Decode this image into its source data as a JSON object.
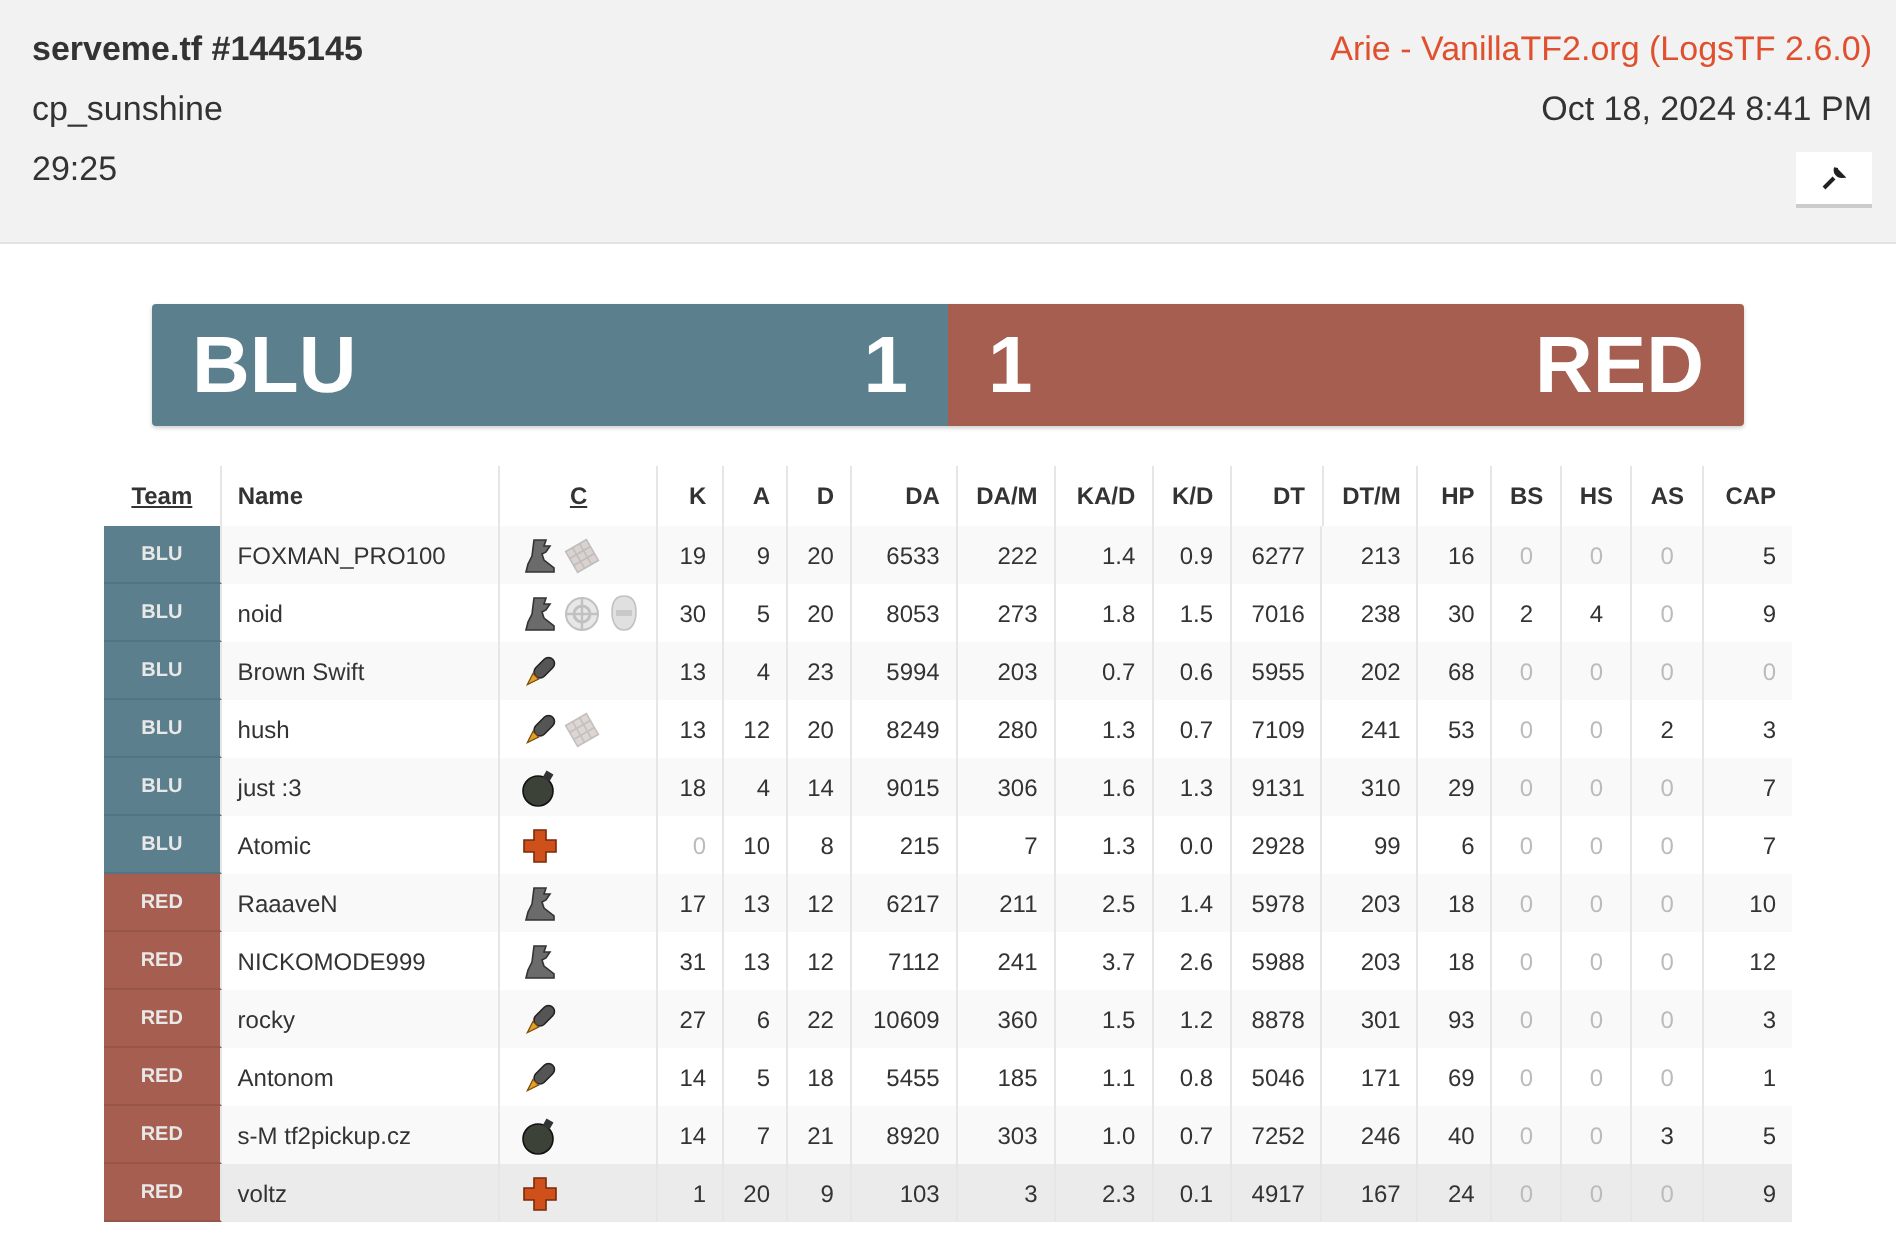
{
  "header": {
    "title": "serveme.tf #1445145",
    "map": "cp_sunshine",
    "duration": "29:25",
    "uploader": "Arie - VanillaTF2.org (LogsTF 2.6.0)",
    "date": "Oct 18, 2024 8:41 PM"
  },
  "score": {
    "blu_name": "BLU",
    "blu_score": "1",
    "red_score": "1",
    "red_name": "RED"
  },
  "table": {
    "columns": [
      {
        "label": "Team",
        "link": true
      },
      {
        "label": "Name",
        "link": false
      },
      {
        "label": "C",
        "link": true
      },
      {
        "label": "K",
        "link": false
      },
      {
        "label": "A",
        "link": false
      },
      {
        "label": "D",
        "link": false
      },
      {
        "label": "DA",
        "link": false
      },
      {
        "label": "DA/M",
        "link": false
      },
      {
        "label": "KA/D",
        "link": false
      },
      {
        "label": "K/D",
        "link": false
      },
      {
        "label": "DT",
        "link": false
      },
      {
        "label": "DT/M",
        "link": false
      },
      {
        "label": "HP",
        "link": false
      },
      {
        "label": "BS",
        "link": false
      },
      {
        "label": "HS",
        "link": false
      },
      {
        "label": "AS",
        "link": false
      },
      {
        "label": "CAP",
        "link": false
      }
    ],
    "rows": [
      {
        "team": "BLU",
        "kind": "blu",
        "name": "FOXMAN_PRO100",
        "highlighted": false,
        "classes": [
          {
            "kind": "boot",
            "faded": false
          },
          {
            "kind": "grid",
            "faded": true
          }
        ],
        "stats": [
          {
            "value": "19",
            "dimmed": false
          },
          {
            "value": "9",
            "dimmed": false
          },
          {
            "value": "20",
            "dimmed": false
          },
          {
            "value": "6533",
            "dimmed": false
          },
          {
            "value": "222",
            "dimmed": false
          },
          {
            "value": "1.4",
            "dimmed": false
          },
          {
            "value": "0.9",
            "dimmed": false
          },
          {
            "value": "6277",
            "dimmed": false
          },
          {
            "value": "213",
            "dimmed": false
          },
          {
            "value": "16",
            "dimmed": false
          },
          {
            "value": "0",
            "dimmed": true
          },
          {
            "value": "0",
            "dimmed": true
          },
          {
            "value": "0",
            "dimmed": true
          },
          {
            "value": "5",
            "dimmed": false
          }
        ]
      },
      {
        "team": "BLU",
        "kind": "blu",
        "name": "noid",
        "highlighted": false,
        "classes": [
          {
            "kind": "boot",
            "faded": false
          },
          {
            "kind": "crosshair",
            "faded": true
          },
          {
            "kind": "mask",
            "faded": true
          }
        ],
        "stats": [
          {
            "value": "30",
            "dimmed": false
          },
          {
            "value": "5",
            "dimmed": false
          },
          {
            "value": "20",
            "dimmed": false
          },
          {
            "value": "8053",
            "dimmed": false
          },
          {
            "value": "273",
            "dimmed": false
          },
          {
            "value": "1.8",
            "dimmed": false
          },
          {
            "value": "1.5",
            "dimmed": false
          },
          {
            "value": "7016",
            "dimmed": false
          },
          {
            "value": "238",
            "dimmed": false
          },
          {
            "value": "30",
            "dimmed": false
          },
          {
            "value": "2",
            "dimmed": false
          },
          {
            "value": "4",
            "dimmed": false
          },
          {
            "value": "0",
            "dimmed": true
          },
          {
            "value": "9",
            "dimmed": false
          }
        ]
      },
      {
        "team": "BLU",
        "kind": "blu",
        "name": "Brown Swift",
        "highlighted": false,
        "classes": [
          {
            "kind": "rocket",
            "faded": false
          }
        ],
        "stats": [
          {
            "value": "13",
            "dimmed": false
          },
          {
            "value": "4",
            "dimmed": false
          },
          {
            "value": "23",
            "dimmed": false
          },
          {
            "value": "5994",
            "dimmed": false
          },
          {
            "value": "203",
            "dimmed": false
          },
          {
            "value": "0.7",
            "dimmed": false
          },
          {
            "value": "0.6",
            "dimmed": false
          },
          {
            "value": "5955",
            "dimmed": false
          },
          {
            "value": "202",
            "dimmed": false
          },
          {
            "value": "68",
            "dimmed": false
          },
          {
            "value": "0",
            "dimmed": true
          },
          {
            "value": "0",
            "dimmed": true
          },
          {
            "value": "0",
            "dimmed": true
          },
          {
            "value": "0",
            "dimmed": true
          }
        ]
      },
      {
        "team": "BLU",
        "kind": "blu",
        "name": "hush",
        "highlighted": false,
        "classes": [
          {
            "kind": "rocket",
            "faded": false
          },
          {
            "kind": "grid",
            "faded": true
          }
        ],
        "stats": [
          {
            "value": "13",
            "dimmed": false
          },
          {
            "value": "12",
            "dimmed": false
          },
          {
            "value": "20",
            "dimmed": false
          },
          {
            "value": "8249",
            "dimmed": false
          },
          {
            "value": "280",
            "dimmed": false
          },
          {
            "value": "1.3",
            "dimmed": false
          },
          {
            "value": "0.7",
            "dimmed": false
          },
          {
            "value": "7109",
            "dimmed": false
          },
          {
            "value": "241",
            "dimmed": false
          },
          {
            "value": "53",
            "dimmed": false
          },
          {
            "value": "0",
            "dimmed": true
          },
          {
            "value": "0",
            "dimmed": true
          },
          {
            "value": "2",
            "dimmed": false
          },
          {
            "value": "3",
            "dimmed": false
          }
        ]
      },
      {
        "team": "BLU",
        "kind": "blu",
        "name": "just :3",
        "highlighted": false,
        "classes": [
          {
            "kind": "bomb",
            "faded": false
          }
        ],
        "stats": [
          {
            "value": "18",
            "dimmed": false
          },
          {
            "value": "4",
            "dimmed": false
          },
          {
            "value": "14",
            "dimmed": false
          },
          {
            "value": "9015",
            "dimmed": false
          },
          {
            "value": "306",
            "dimmed": false
          },
          {
            "value": "1.6",
            "dimmed": false
          },
          {
            "value": "1.3",
            "dimmed": false
          },
          {
            "value": "9131",
            "dimmed": false
          },
          {
            "value": "310",
            "dimmed": false
          },
          {
            "value": "29",
            "dimmed": false
          },
          {
            "value": "0",
            "dimmed": true
          },
          {
            "value": "0",
            "dimmed": true
          },
          {
            "value": "0",
            "dimmed": true
          },
          {
            "value": "7",
            "dimmed": false
          }
        ]
      },
      {
        "team": "BLU",
        "kind": "blu",
        "name": "Atomic",
        "highlighted": false,
        "classes": [
          {
            "kind": "cross",
            "faded": false
          }
        ],
        "stats": [
          {
            "value": "0",
            "dimmed": true
          },
          {
            "value": "10",
            "dimmed": false
          },
          {
            "value": "8",
            "dimmed": false
          },
          {
            "value": "215",
            "dimmed": false
          },
          {
            "value": "7",
            "dimmed": false
          },
          {
            "value": "1.3",
            "dimmed": false
          },
          {
            "value": "0.0",
            "dimmed": false
          },
          {
            "value": "2928",
            "dimmed": false
          },
          {
            "value": "99",
            "dimmed": false
          },
          {
            "value": "6",
            "dimmed": false
          },
          {
            "value": "0",
            "dimmed": true
          },
          {
            "value": "0",
            "dimmed": true
          },
          {
            "value": "0",
            "dimmed": true
          },
          {
            "value": "7",
            "dimmed": false
          }
        ]
      },
      {
        "team": "RED",
        "kind": "red",
        "name": "RaaaveN",
        "highlighted": false,
        "classes": [
          {
            "kind": "boot",
            "faded": false
          }
        ],
        "stats": [
          {
            "value": "17",
            "dimmed": false
          },
          {
            "value": "13",
            "dimmed": false
          },
          {
            "value": "12",
            "dimmed": false
          },
          {
            "value": "6217",
            "dimmed": false
          },
          {
            "value": "211",
            "dimmed": false
          },
          {
            "value": "2.5",
            "dimmed": false
          },
          {
            "value": "1.4",
            "dimmed": false
          },
          {
            "value": "5978",
            "dimmed": false
          },
          {
            "value": "203",
            "dimmed": false
          },
          {
            "value": "18",
            "dimmed": false
          },
          {
            "value": "0",
            "dimmed": true
          },
          {
            "value": "0",
            "dimmed": true
          },
          {
            "value": "0",
            "dimmed": true
          },
          {
            "value": "10",
            "dimmed": false
          }
        ]
      },
      {
        "team": "RED",
        "kind": "red",
        "name": "NICKOMODE999",
        "highlighted": false,
        "classes": [
          {
            "kind": "boot",
            "faded": false
          }
        ],
        "stats": [
          {
            "value": "31",
            "dimmed": false
          },
          {
            "value": "13",
            "dimmed": false
          },
          {
            "value": "12",
            "dimmed": false
          },
          {
            "value": "7112",
            "dimmed": false
          },
          {
            "value": "241",
            "dimmed": false
          },
          {
            "value": "3.7",
            "dimmed": false
          },
          {
            "value": "2.6",
            "dimmed": false
          },
          {
            "value": "5988",
            "dimmed": false
          },
          {
            "value": "203",
            "dimmed": false
          },
          {
            "value": "18",
            "dimmed": false
          },
          {
            "value": "0",
            "dimmed": true
          },
          {
            "value": "0",
            "dimmed": true
          },
          {
            "value": "0",
            "dimmed": true
          },
          {
            "value": "12",
            "dimmed": false
          }
        ]
      },
      {
        "team": "RED",
        "kind": "red",
        "name": "rocky",
        "highlighted": false,
        "classes": [
          {
            "kind": "rocket",
            "faded": false
          }
        ],
        "stats": [
          {
            "value": "27",
            "dimmed": false
          },
          {
            "value": "6",
            "dimmed": false
          },
          {
            "value": "22",
            "dimmed": false
          },
          {
            "value": "10609",
            "dimmed": false
          },
          {
            "value": "360",
            "dimmed": false
          },
          {
            "value": "1.5",
            "dimmed": false
          },
          {
            "value": "1.2",
            "dimmed": false
          },
          {
            "value": "8878",
            "dimmed": false
          },
          {
            "value": "301",
            "dimmed": false
          },
          {
            "value": "93",
            "dimmed": false
          },
          {
            "value": "0",
            "dimmed": true
          },
          {
            "value": "0",
            "dimmed": true
          },
          {
            "value": "0",
            "dimmed": true
          },
          {
            "value": "3",
            "dimmed": false
          }
        ]
      },
      {
        "team": "RED",
        "kind": "red",
        "name": "Antonom",
        "highlighted": false,
        "classes": [
          {
            "kind": "rocket",
            "faded": false
          }
        ],
        "stats": [
          {
            "value": "14",
            "dimmed": false
          },
          {
            "value": "5",
            "dimmed": false
          },
          {
            "value": "18",
            "dimmed": false
          },
          {
            "value": "5455",
            "dimmed": false
          },
          {
            "value": "185",
            "dimmed": false
          },
          {
            "value": "1.1",
            "dimmed": false
          },
          {
            "value": "0.8",
            "dimmed": false
          },
          {
            "value": "5046",
            "dimmed": false
          },
          {
            "value": "171",
            "dimmed": false
          },
          {
            "value": "69",
            "dimmed": false
          },
          {
            "value": "0",
            "dimmed": true
          },
          {
            "value": "0",
            "dimmed": true
          },
          {
            "value": "0",
            "dimmed": true
          },
          {
            "value": "1",
            "dimmed": false
          }
        ]
      },
      {
        "team": "RED",
        "kind": "red",
        "name": "s-M tf2pickup.cz",
        "highlighted": false,
        "classes": [
          {
            "kind": "bomb",
            "faded": false
          }
        ],
        "stats": [
          {
            "value": "14",
            "dimmed": false
          },
          {
            "value": "7",
            "dimmed": false
          },
          {
            "value": "21",
            "dimmed": false
          },
          {
            "value": "8920",
            "dimmed": false
          },
          {
            "value": "303",
            "dimmed": false
          },
          {
            "value": "1.0",
            "dimmed": false
          },
          {
            "value": "0.7",
            "dimmed": false
          },
          {
            "value": "7252",
            "dimmed": false
          },
          {
            "value": "246",
            "dimmed": false
          },
          {
            "value": "40",
            "dimmed": false
          },
          {
            "value": "0",
            "dimmed": true
          },
          {
            "value": "0",
            "dimmed": true
          },
          {
            "value": "3",
            "dimmed": false
          },
          {
            "value": "5",
            "dimmed": false
          }
        ]
      },
      {
        "team": "RED",
        "kind": "red",
        "name": "voltz",
        "highlighted": true,
        "classes": [
          {
            "kind": "cross",
            "faded": false
          }
        ],
        "stats": [
          {
            "value": "1",
            "dimmed": false
          },
          {
            "value": "20",
            "dimmed": false
          },
          {
            "value": "9",
            "dimmed": false
          },
          {
            "value": "103",
            "dimmed": false
          },
          {
            "value": "3",
            "dimmed": false
          },
          {
            "value": "2.3",
            "dimmed": false
          },
          {
            "value": "0.1",
            "dimmed": false
          },
          {
            "value": "4917",
            "dimmed": false
          },
          {
            "value": "167",
            "dimmed": false
          },
          {
            "value": "24",
            "dimmed": false
          },
          {
            "value": "0",
            "dimmed": true
          },
          {
            "value": "0",
            "dimmed": true
          },
          {
            "value": "0",
            "dimmed": true
          },
          {
            "value": "9",
            "dimmed": false
          }
        ]
      }
    ]
  }
}
